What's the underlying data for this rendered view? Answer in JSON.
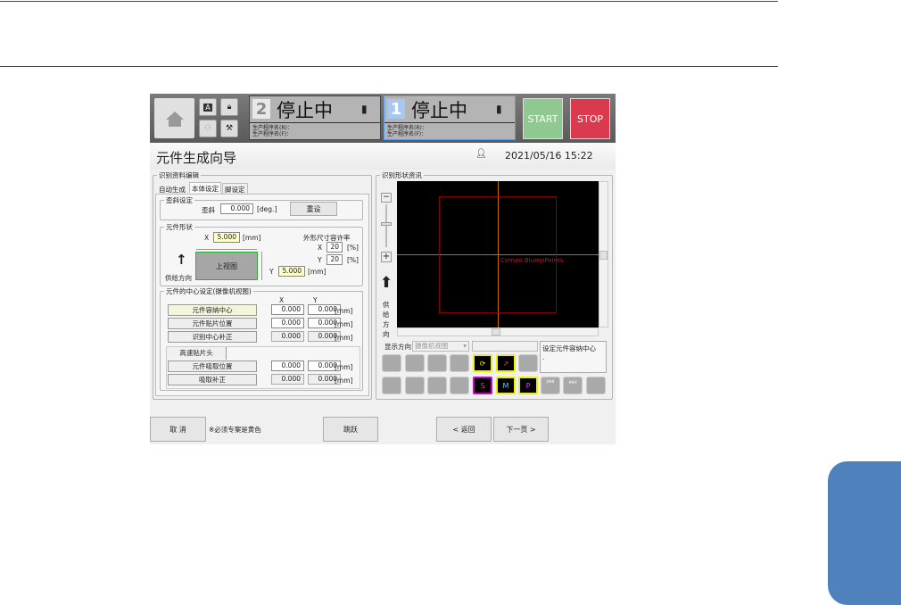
{
  "header": {
    "stations": [
      {
        "number": "2",
        "status": "停止中",
        "prog_r": "生产程序名(R)：",
        "prog_f": "生产程序名(F)："
      },
      {
        "number": "1",
        "status": "停止中",
        "prog_r": "生产程序名(R)：",
        "prog_f": "生产程序名(F)："
      }
    ],
    "start_label": "START",
    "stop_label": "STOP",
    "auto_icon_label": "A"
  },
  "title": "元件生成向导",
  "datetime": "2021/05/16 15:22",
  "left": {
    "group_title": "识别资料编辑",
    "tabs": [
      "自动生成",
      "本体设定",
      "脚设定"
    ],
    "skew": {
      "title": "歪斜设定",
      "label": "歪斜",
      "value": "0.000",
      "unit": "[deg.]",
      "reset": "重设"
    },
    "shape": {
      "title": "元件形状",
      "x_label": "X",
      "x_value": "5.000",
      "y_label": "Y",
      "y_value": "5.000",
      "unit": "[mm]",
      "top_view": "上视图",
      "feed_dir": "供给方向",
      "tol_title": "外形尺寸容许率",
      "tol_x_label": "X",
      "tol_x": "20",
      "tol_y_label": "Y",
      "tol_y": "20",
      "pct": "[%]"
    },
    "center": {
      "title": "元件的中心设定(摄像机视图)",
      "col_x": "X",
      "col_y": "Y",
      "rows": [
        {
          "label": "元件容纳中心",
          "x": "0.000",
          "y": "0.000",
          "unit": "[mm]"
        },
        {
          "label": "元件贴片位置",
          "x": "0.000",
          "y": "0.000",
          "unit": "[mm]"
        },
        {
          "label": "识别中心补正",
          "x": "0.000",
          "y": "0.000",
          "unit": "[mm]"
        }
      ],
      "head_tab": "高速贴片头",
      "head_rows": [
        {
          "label": "元件吸取位置",
          "x": "0.000",
          "y": "0.000",
          "unit": "[mm]"
        },
        {
          "label": "吸取补正",
          "x": "0.000",
          "y": "0.000",
          "unit": "[mm]"
        }
      ]
    }
  },
  "right": {
    "group_title": "识别形状资讯",
    "feed_dir_chars": [
      "供",
      "给",
      "方",
      "向"
    ],
    "overlay_text": "Compo.BlumpPoInts.",
    "display_dir_label": "显示方向",
    "display_dir_value": "摄像机视图",
    "info_text": "设定元件容纳中心",
    "info_sub": ".",
    "icon_letters": [
      "S",
      "M",
      "P"
    ]
  },
  "footer": {
    "cancel": "取 消",
    "note": "※必须专案是黄色",
    "skip": "跳跃",
    "back": "< 返回",
    "next": "下一页 >"
  }
}
